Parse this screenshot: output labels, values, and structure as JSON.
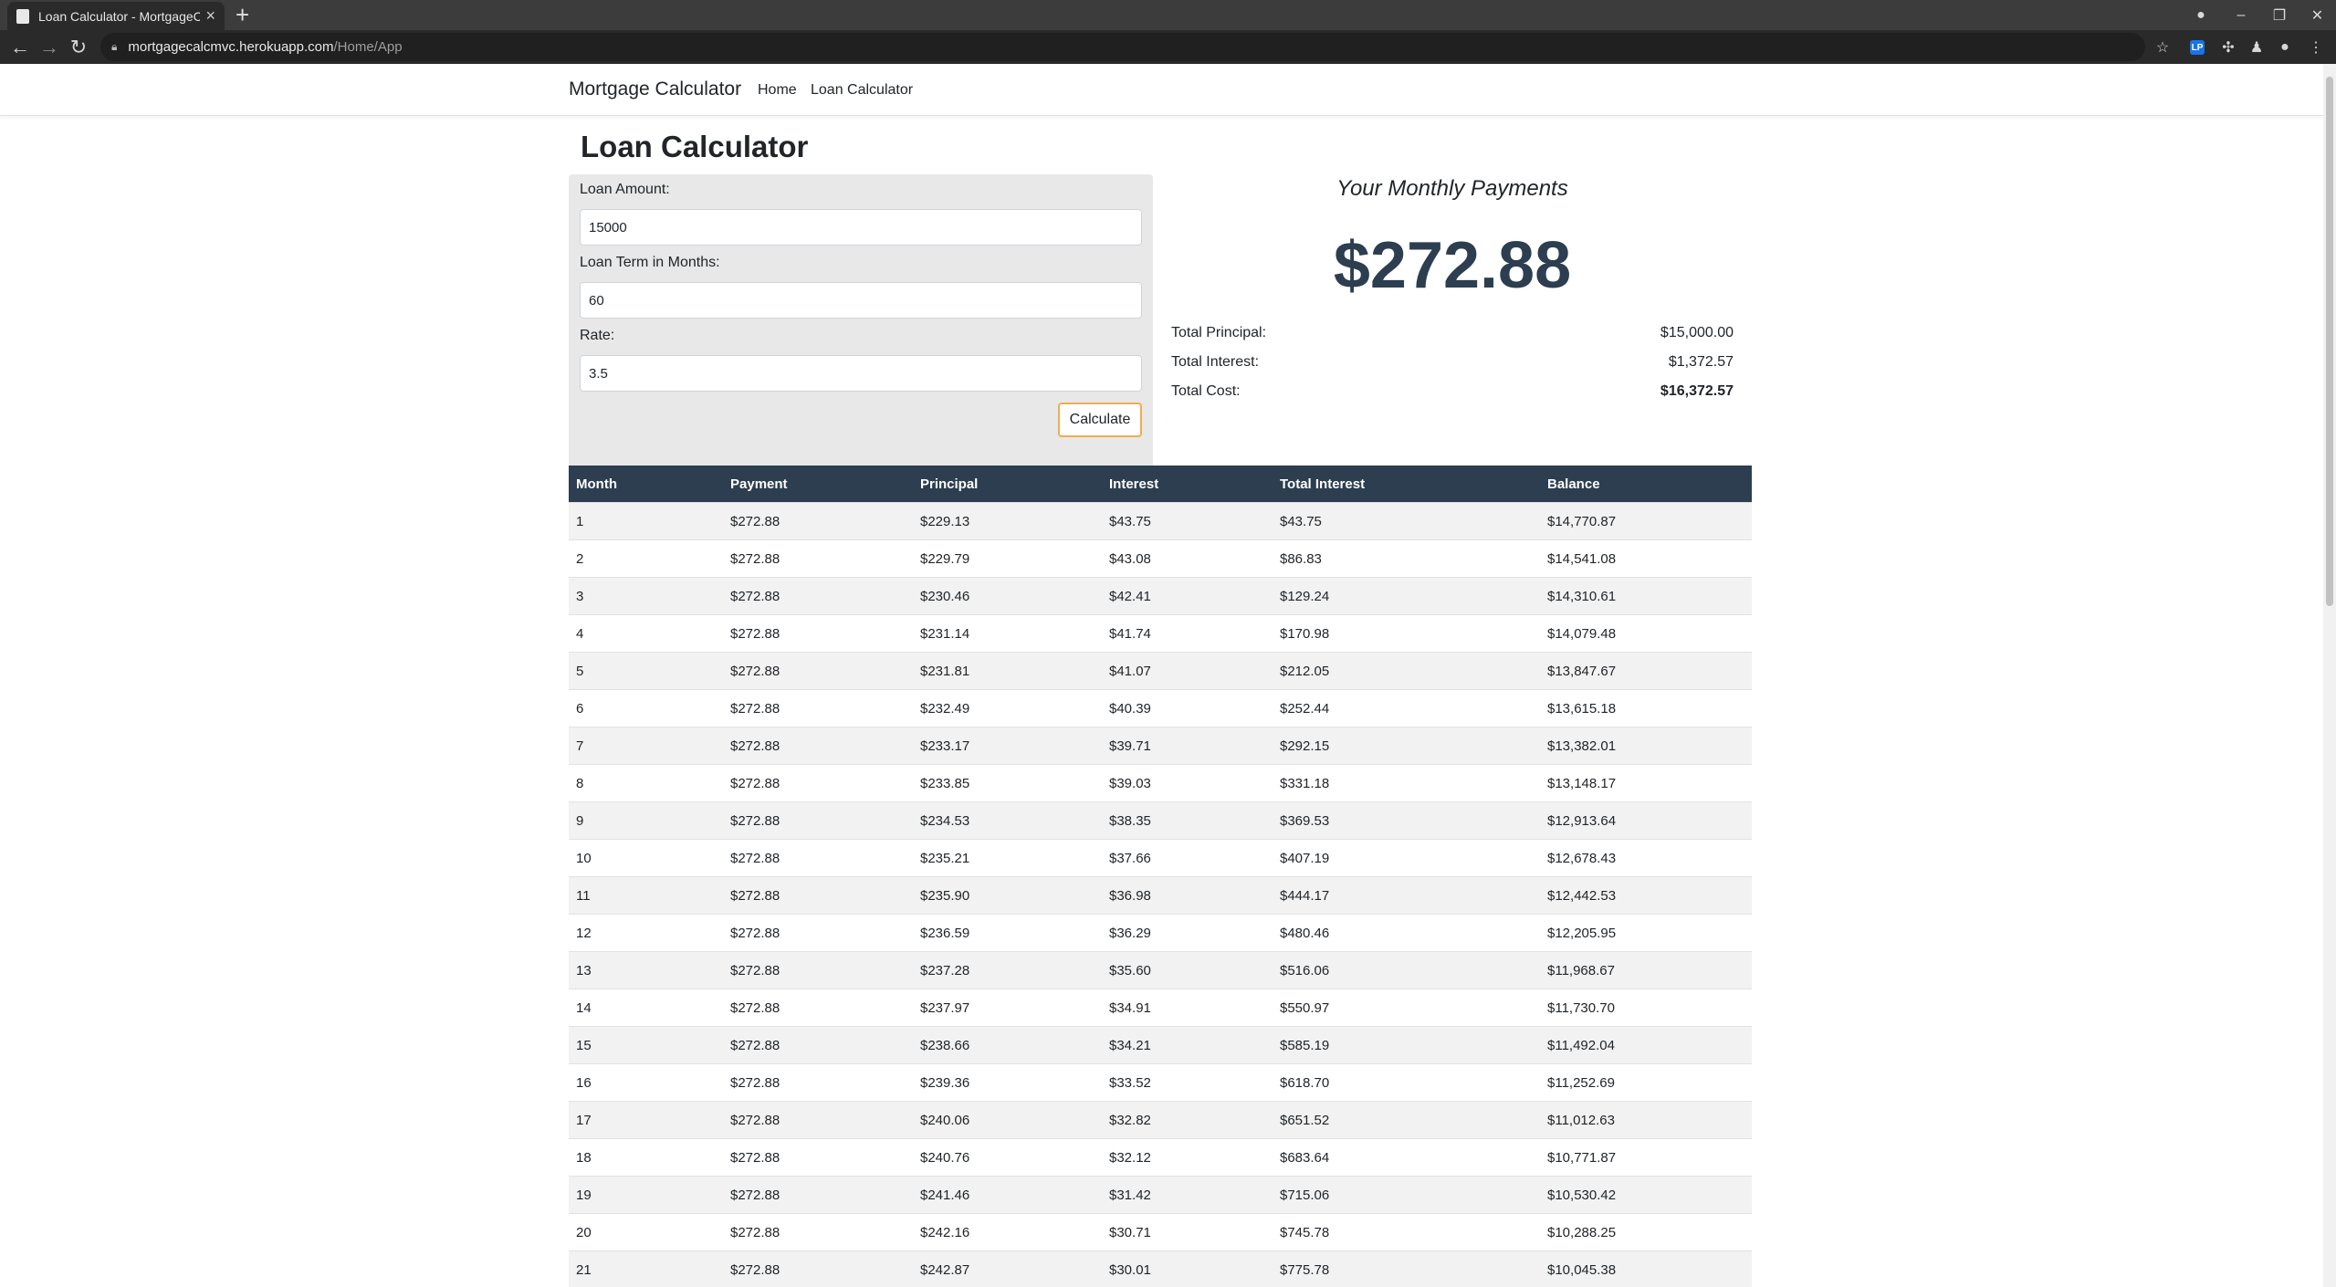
{
  "browser": {
    "tab_title": "Loan Calculator - MortgageCalcM",
    "url_host": "mortgagecalcmvc.herokuapp.com",
    "url_path": "/Home/App"
  },
  "site": {
    "brand": "Mortgage Calculator",
    "nav": [
      "Home",
      "Loan Calculator"
    ]
  },
  "page_title": "Loan Calculator",
  "form": {
    "loan_amount_label": "Loan Amount:",
    "loan_amount_value": "15000",
    "term_label": "Loan Term in Months:",
    "term_value": "60",
    "rate_label": "Rate:",
    "rate_value": "3.5",
    "calculate_label": "Calculate"
  },
  "results": {
    "heading": "Your Monthly Payments",
    "monthly_payment": "$272.88",
    "summary": [
      {
        "label": "Total Principal:",
        "value": "$15,000.00",
        "bold": false
      },
      {
        "label": "Total Interest:",
        "value": "$1,372.57",
        "bold": false
      },
      {
        "label": "Total Cost:",
        "value": "$16,372.57",
        "bold": true
      }
    ]
  },
  "schedule": {
    "headers": [
      "Month",
      "Payment",
      "Principal",
      "Interest",
      "Total Interest",
      "Balance"
    ],
    "rows": [
      [
        "1",
        "$272.88",
        "$229.13",
        "$43.75",
        "$43.75",
        "$14,770.87"
      ],
      [
        "2",
        "$272.88",
        "$229.79",
        "$43.08",
        "$86.83",
        "$14,541.08"
      ],
      [
        "3",
        "$272.88",
        "$230.46",
        "$42.41",
        "$129.24",
        "$14,310.61"
      ],
      [
        "4",
        "$272.88",
        "$231.14",
        "$41.74",
        "$170.98",
        "$14,079.48"
      ],
      [
        "5",
        "$272.88",
        "$231.81",
        "$41.07",
        "$212.05",
        "$13,847.67"
      ],
      [
        "6",
        "$272.88",
        "$232.49",
        "$40.39",
        "$252.44",
        "$13,615.18"
      ],
      [
        "7",
        "$272.88",
        "$233.17",
        "$39.71",
        "$292.15",
        "$13,382.01"
      ],
      [
        "8",
        "$272.88",
        "$233.85",
        "$39.03",
        "$331.18",
        "$13,148.17"
      ],
      [
        "9",
        "$272.88",
        "$234.53",
        "$38.35",
        "$369.53",
        "$12,913.64"
      ],
      [
        "10",
        "$272.88",
        "$235.21",
        "$37.66",
        "$407.19",
        "$12,678.43"
      ],
      [
        "11",
        "$272.88",
        "$235.90",
        "$36.98",
        "$444.17",
        "$12,442.53"
      ],
      [
        "12",
        "$272.88",
        "$236.59",
        "$36.29",
        "$480.46",
        "$12,205.95"
      ],
      [
        "13",
        "$272.88",
        "$237.28",
        "$35.60",
        "$516.06",
        "$11,968.67"
      ],
      [
        "14",
        "$272.88",
        "$237.97",
        "$34.91",
        "$550.97",
        "$11,730.70"
      ],
      [
        "15",
        "$272.88",
        "$238.66",
        "$34.21",
        "$585.19",
        "$11,492.04"
      ],
      [
        "16",
        "$272.88",
        "$239.36",
        "$33.52",
        "$618.70",
        "$11,252.69"
      ],
      [
        "17",
        "$272.88",
        "$240.06",
        "$32.82",
        "$651.52",
        "$11,012.63"
      ],
      [
        "18",
        "$272.88",
        "$240.76",
        "$32.12",
        "$683.64",
        "$10,771.87"
      ],
      [
        "19",
        "$272.88",
        "$241.46",
        "$31.42",
        "$715.06",
        "$10,530.42"
      ],
      [
        "20",
        "$272.88",
        "$242.16",
        "$30.71",
        "$745.78",
        "$10,288.25"
      ],
      [
        "21",
        "$272.88",
        "$242.87",
        "$30.01",
        "$775.78",
        "$10,045.38"
      ]
    ]
  }
}
